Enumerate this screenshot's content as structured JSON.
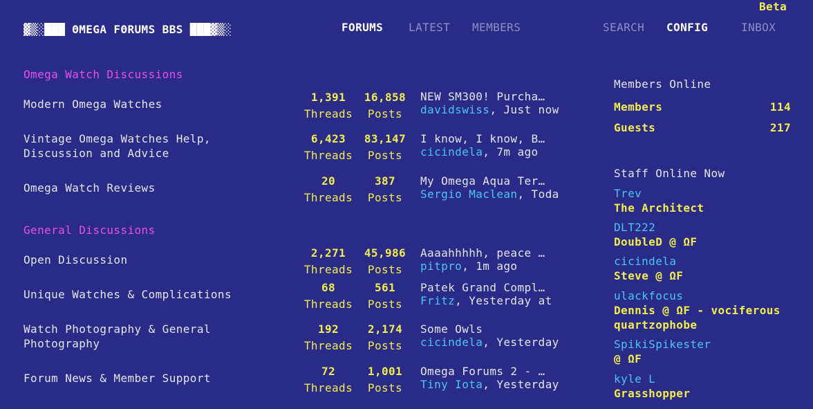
{
  "header": {
    "beta": "Beta",
    "logo": "▓▒░███ ΘMEGA FΘRUMS BBS ███▓▒░",
    "nav": {
      "forums": "FORUMS",
      "latest": "LATEST",
      "members": "MEMBERS",
      "search": "SEARCH",
      "config": "CONFIG",
      "inbox": "INBOX"
    }
  },
  "categories": [
    {
      "title": "Omega Watch Discussions",
      "forums": [
        {
          "name_lines": [
            "Modern Omega Watches"
          ],
          "threads": "1,391",
          "posts": "16,858",
          "latest_title": "NEW SM300! Purcha…",
          "latest_user": "davidswiss",
          "latest_time": ", Just now"
        },
        {
          "name_lines": [
            "Vintage Omega Watches Help,",
            "Discussion and Advice"
          ],
          "threads": "6,423",
          "posts": "83,147",
          "latest_title": "I know, I know, B…",
          "latest_user": "cicindela",
          "latest_time": ", 7m ago"
        },
        {
          "name_lines": [
            "Omega Watch Reviews"
          ],
          "threads": "20",
          "posts": "387",
          "latest_title": "My Omega Aqua Ter…",
          "latest_user": "Sergio Maclean",
          "latest_time": ", Toda"
        }
      ]
    },
    {
      "title": "General Discussions",
      "forums": [
        {
          "name_lines": [
            "Open Discussion"
          ],
          "threads": "2,271",
          "posts": "45,986",
          "latest_title": "Aaaahhhhh, peace …",
          "latest_user": "pitpro",
          "latest_time": ", 1m ago"
        },
        {
          "name_lines": [
            "Unique Watches & Complications"
          ],
          "threads": "68",
          "posts": "561",
          "latest_title": "Patek Grand Compl…",
          "latest_user": "Fritz",
          "latest_time": ", Yesterday at"
        },
        {
          "name_lines": [
            "Watch Photography & General",
            "Photography"
          ],
          "threads": "192",
          "posts": "2,174",
          "latest_title": "Some Owls",
          "latest_user": "cicindela",
          "latest_time": ", Yesterday"
        },
        {
          "name_lines": [
            "Forum News & Member Support"
          ],
          "threads": "72",
          "posts": "1,001",
          "latest_title": "Omega Forums 2 - …",
          "latest_user": "Tiny Iota",
          "latest_time": ", Yesterday"
        }
      ]
    }
  ],
  "labels": {
    "threads": "Threads",
    "posts": "Posts"
  },
  "sidebar": {
    "members_online_title": "Members Online",
    "members_label": "Members",
    "members_count": "114",
    "guests_label": "Guests",
    "guests_count": "217",
    "staff_title": "Staff Online Now",
    "staff": [
      {
        "name": "Trev",
        "role": "The Architect"
      },
      {
        "name": "DLT222",
        "role": "DoubleD @ ΩF"
      },
      {
        "name": "cicindela",
        "role": "Steve @ ΩF"
      },
      {
        "name": "ulackfocus",
        "role": "Dennis @ ΩF - vociferous quartzophobe"
      },
      {
        "name": "SpikiSpikester",
        "role": "@ ΩF"
      },
      {
        "name": "kyle L",
        "role": "Grasshopper"
      }
    ]
  },
  "colors": {
    "background": "#2a2a88",
    "category": "#e94fe9",
    "stat": "#f2ef4d",
    "username": "#48c8f0"
  }
}
